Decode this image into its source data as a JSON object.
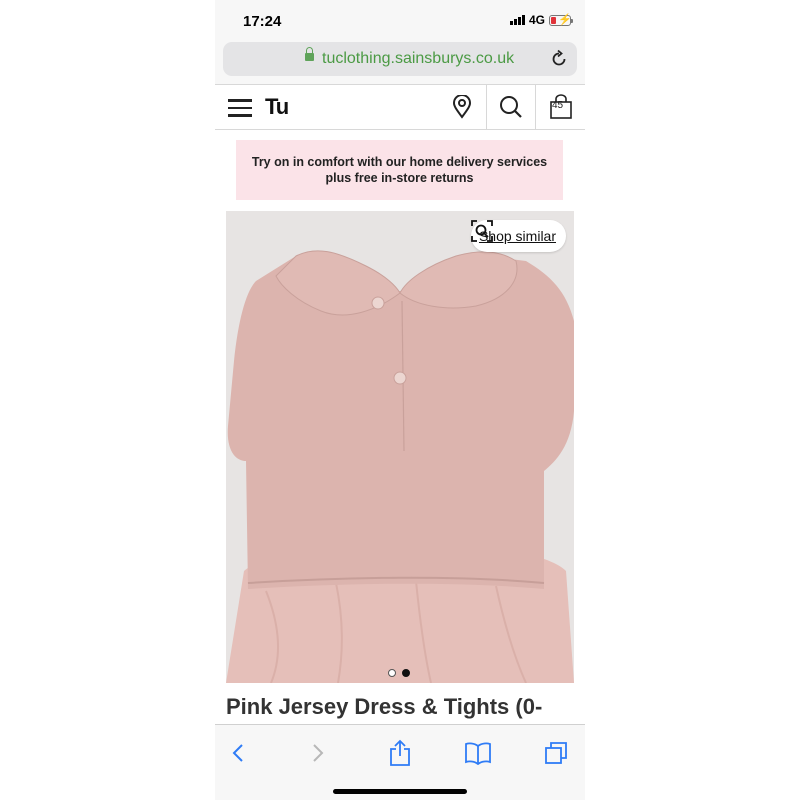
{
  "status": {
    "time": "17:24",
    "network": "4G",
    "signal_icon": "signal-bars-icon",
    "battery_icon": "battery-charging-icon",
    "battery_color": "#e0333a"
  },
  "browser": {
    "url": "tuclothing.sainsburys.co.uk",
    "url_color": "#4b9a44",
    "lock_icon": "lock-icon",
    "reload_icon": "reload-icon",
    "toolbar": {
      "back_icon": "chevron-left-icon",
      "forward_icon": "chevron-right-icon",
      "share_icon": "share-icon",
      "bookmarks_icon": "book-icon",
      "tabs_icon": "tabs-icon"
    }
  },
  "header": {
    "menu_icon": "hamburger-menu-icon",
    "logo_text": "Tu",
    "store_locator_icon": "location-pin-icon",
    "search_icon": "search-icon",
    "bag_icon": "shopping-bag-icon",
    "bag_count": "45"
  },
  "promo": {
    "text": "Try on in comfort with our home delivery services plus free in-store returns",
    "background": "#fbe3e8"
  },
  "product": {
    "image_description_color": "#dcb4ae",
    "shop_similar_label": "Shop similar",
    "shop_similar_icon": "visual-search-icon",
    "carousel": {
      "total": 2,
      "active": 2
    },
    "title": "Pink Jersey Dress & Tights (0-"
  }
}
